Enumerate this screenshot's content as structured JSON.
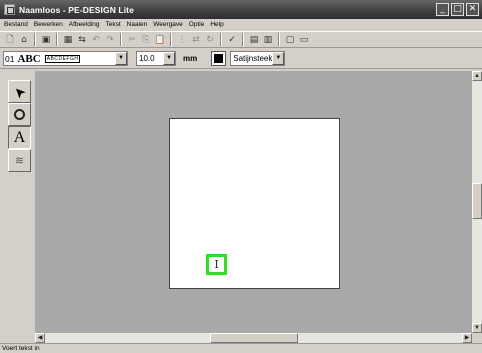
{
  "window": {
    "title": "Naamloos - PE-DESIGN Lite",
    "controls": [
      "minimize-icon",
      "maximize-icon",
      "close-icon"
    ],
    "control_glyphs": {
      "minimize": "_",
      "maximize": "□",
      "close": "✕"
    }
  },
  "menu": {
    "items": [
      {
        "label": "Bestand"
      },
      {
        "label": "Bewerken"
      },
      {
        "label": "Afbeelding"
      },
      {
        "label": "Tekst"
      },
      {
        "label": "Naaien"
      },
      {
        "label": "Weergave"
      },
      {
        "label": "Optie"
      },
      {
        "label": "Help"
      }
    ]
  },
  "toolbar": {
    "icons": {
      "new": "🗋",
      "open": "⌂",
      "save": "▣",
      "print": "▦",
      "transfer": "⇆",
      "undo": "↶",
      "redo": "↷",
      "cut": "✂",
      "copy": "⎘",
      "paste": "📋",
      "align": "⋮",
      "flip": "⇄",
      "rotate": "↻",
      "check": "✓",
      "preview": "▤",
      "properties": "▥",
      "view1": "▢",
      "view2": "▭"
    }
  },
  "text_toolbar": {
    "font_number": "01",
    "font_sample_big": "ABC",
    "font_sample_small": "ABCDEFGH",
    "size_value": "10.0",
    "size_unit": "mm",
    "thread_color": "#000000",
    "stitch_type": "Satijnsteek",
    "dropdown_glyph": "▼"
  },
  "tools": [
    {
      "name": "select",
      "glyph": "➤"
    },
    {
      "name": "zoom",
      "glyph": "🔍"
    },
    {
      "name": "text",
      "glyph": "A"
    },
    {
      "name": "stitch",
      "glyph": "≋"
    }
  ],
  "canvas": {
    "workspace_color": "#a9a9a9",
    "hoop_color": "#ffffff",
    "cursor_glyph": "I",
    "cursor_highlight_color": "#33dd22"
  },
  "scrollbars": {
    "up_glyph": "▲",
    "down_glyph": "▼",
    "left_glyph": "◀",
    "right_glyph": "▶"
  },
  "status": {
    "text": "Voert tekst in"
  }
}
